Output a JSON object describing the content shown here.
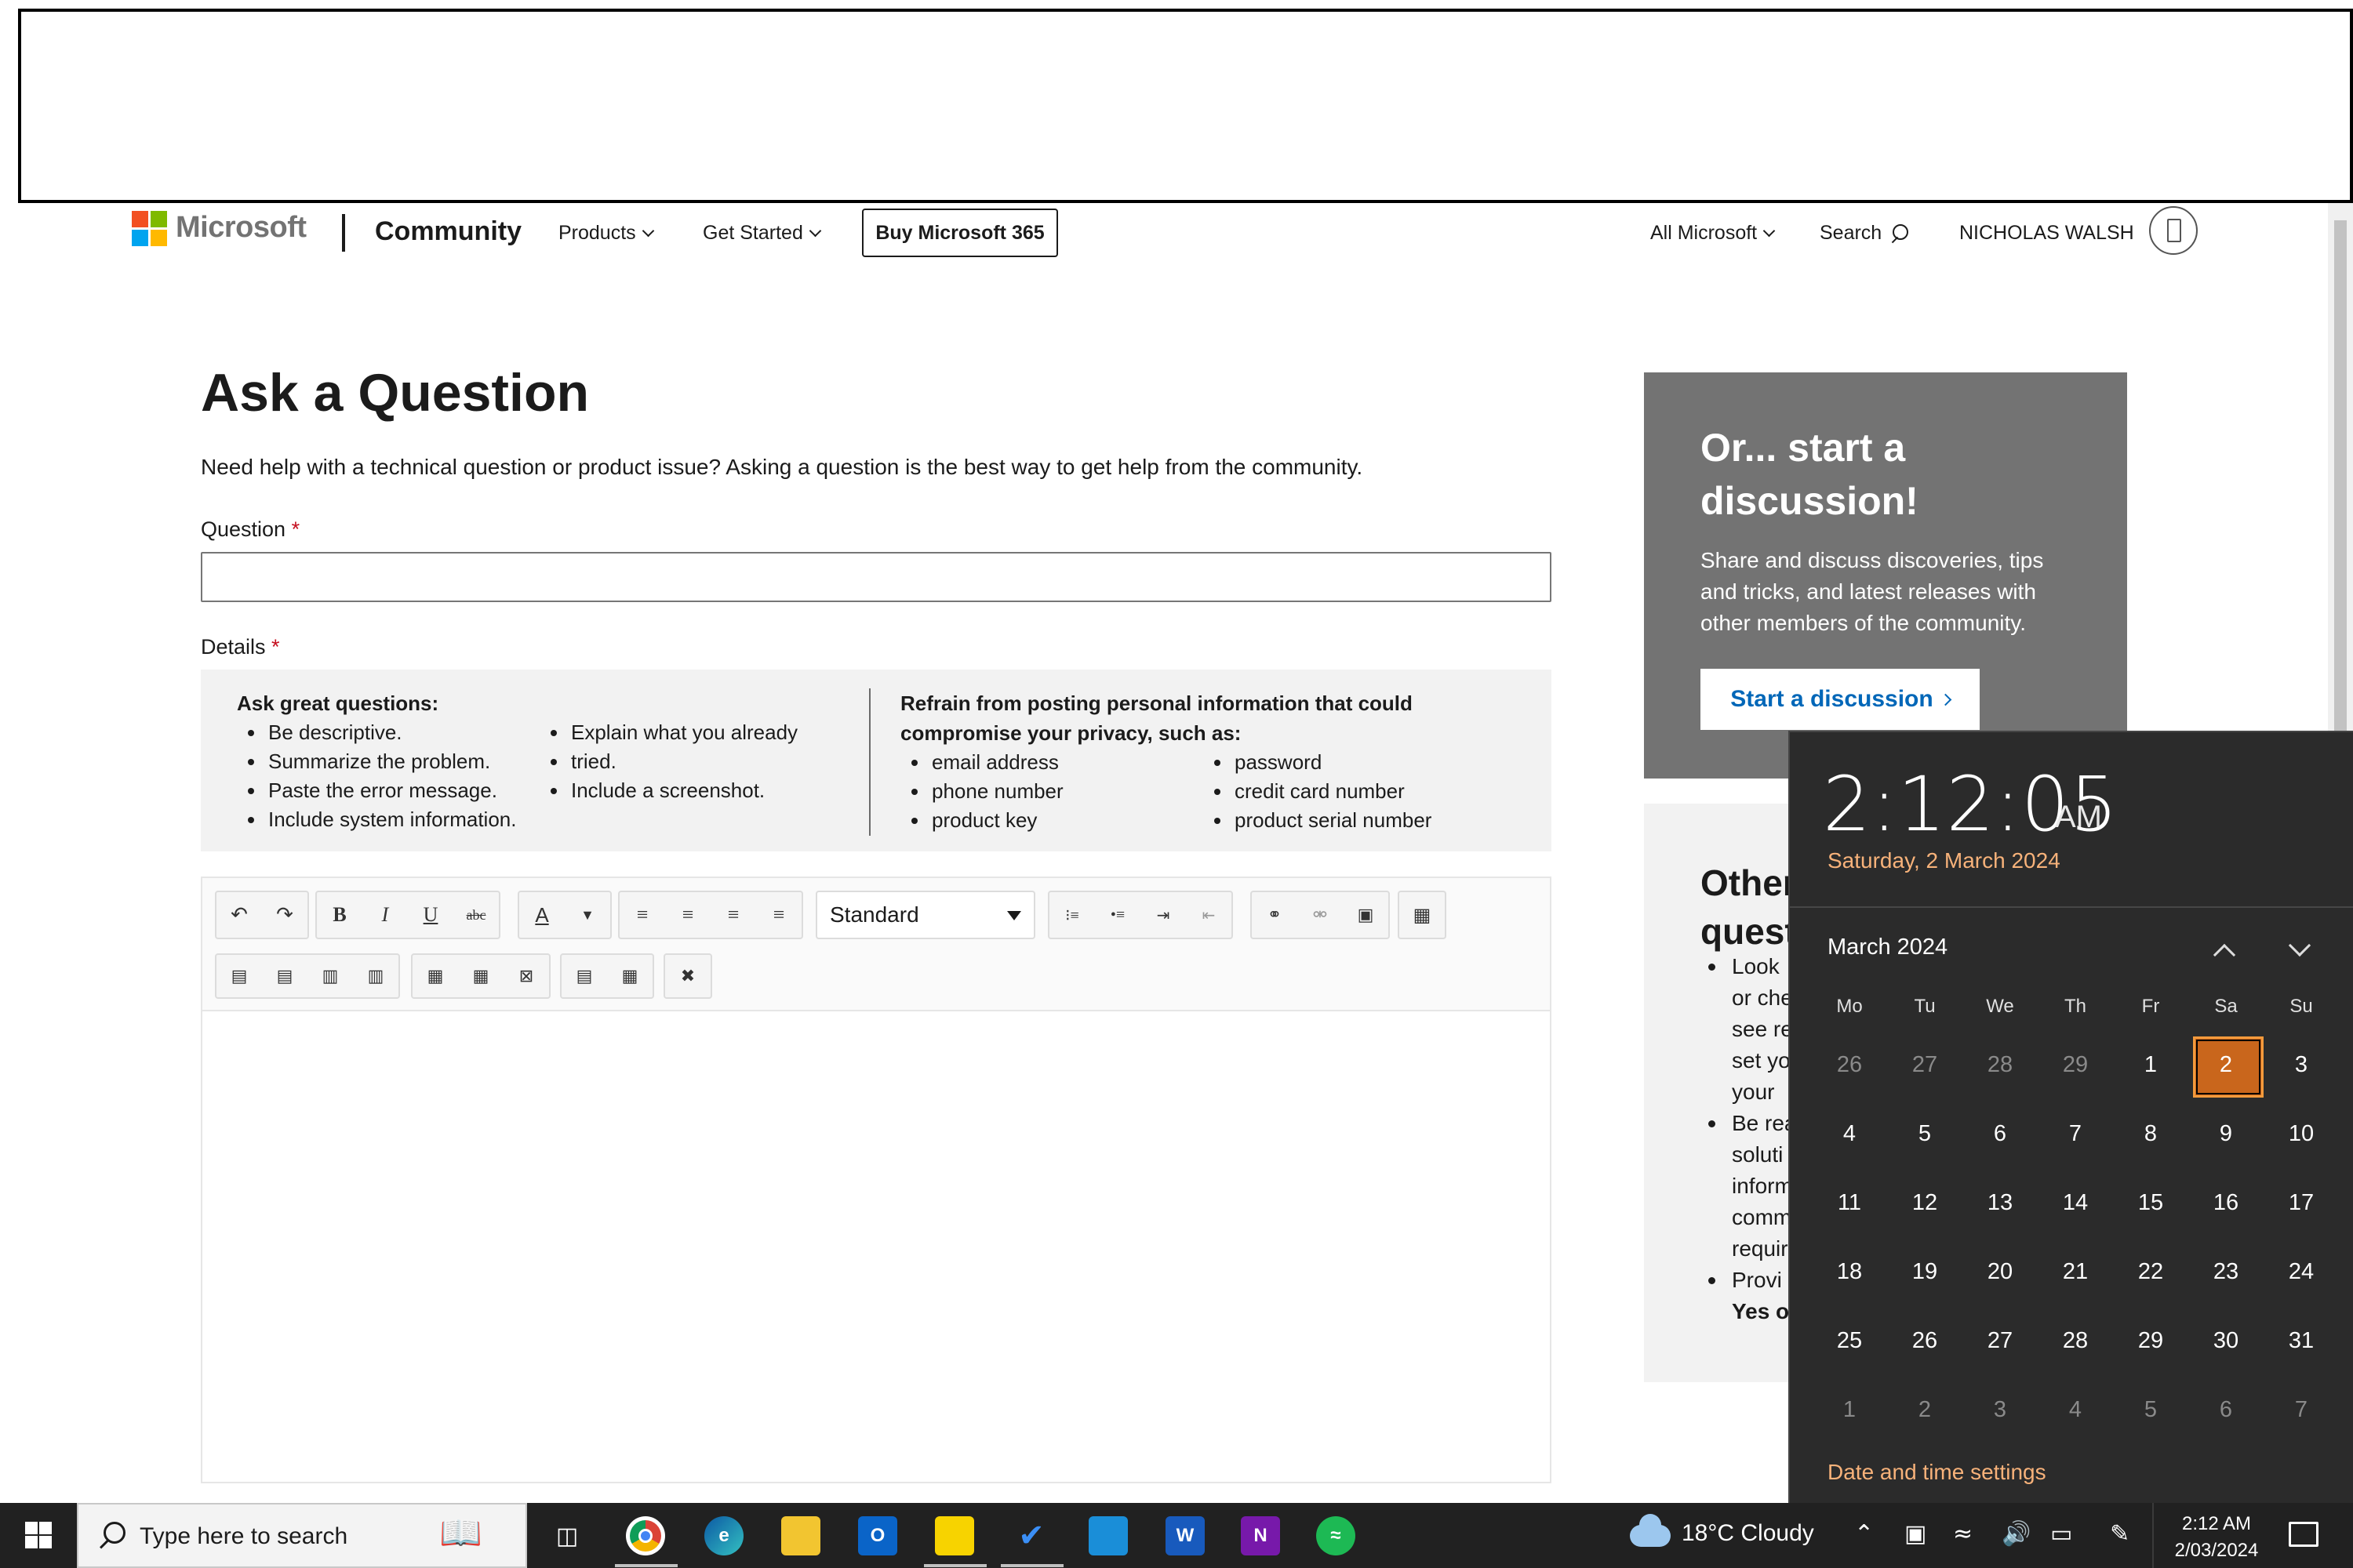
{
  "header": {
    "brand": "Microsoft",
    "site": "Community",
    "nav_products": "Products",
    "nav_get_started": "Get Started",
    "buy_button": "Buy Microsoft 365",
    "all_microsoft": "All Microsoft",
    "search": "Search",
    "user_name": "NICHOLAS WALSH"
  },
  "main": {
    "title": "Ask a Question",
    "intro": "Need help with a technical question or product issue? Asking a question is the best way to get help from the community.",
    "question_label": "Question",
    "details_label": "Details",
    "required_mark": "*",
    "tips": {
      "left_heading": "Ask great questions:",
      "left_col1": [
        "Be descriptive.",
        "Summarize the problem.",
        "Paste the error message.",
        "Include system information."
      ],
      "left_col2": [
        "Explain what you already",
        "tried.",
        "Include a screenshot."
      ],
      "right_heading_1": "Refrain from posting personal information that could",
      "right_heading_2": "compromise your privacy, such as:",
      "right_col1": [
        "email address",
        "phone number",
        "product key"
      ],
      "right_col2": [
        "password",
        "credit card number",
        "product serial number"
      ]
    },
    "editor": {
      "style_select": "Standard",
      "bold": "B",
      "italic": "I",
      "underline": "U",
      "strike": "abc",
      "font_color": "A"
    }
  },
  "sidebar": {
    "discussion_title": "Or... start a discussion!",
    "discussion_text": "Share and discuss discoveries, tips and tricks, and latest releases with other members of the community.",
    "discussion_button": "Start a discussion",
    "other_title_1": "Other",
    "other_title_2": "quest",
    "other_lines": [
      "Look",
      "or che",
      "see re",
      "set yo",
      "your",
      "Be rea",
      "soluti",
      "inform",
      "comm",
      "requir",
      "Provi",
      "Yes o"
    ]
  },
  "clock_flyout": {
    "time": "2:12:05",
    "ampm": "AM",
    "date": "Saturday, 2 March 2024",
    "month": "March 2024",
    "weekdays": [
      "Mo",
      "Tu",
      "We",
      "Th",
      "Fr",
      "Sa",
      "Su"
    ],
    "weeks": [
      [
        "26",
        "27",
        "28",
        "29",
        "1",
        "2",
        "3"
      ],
      [
        "4",
        "5",
        "6",
        "7",
        "8",
        "9",
        "10"
      ],
      [
        "11",
        "12",
        "13",
        "14",
        "15",
        "16",
        "17"
      ],
      [
        "18",
        "19",
        "20",
        "21",
        "22",
        "23",
        "24"
      ],
      [
        "25",
        "26",
        "27",
        "28",
        "29",
        "30",
        "31"
      ],
      [
        "1",
        "2",
        "3",
        "4",
        "5",
        "6",
        "7"
      ]
    ],
    "selected_day": "2",
    "settings_link": "Date and time settings"
  },
  "taskbar": {
    "search_placeholder": "Type here to search",
    "weather": "18°C  Cloudy",
    "clock_time": "2:12 AM",
    "clock_date": "2/03/2024",
    "apps": [
      "task-view-icon",
      "chrome-icon",
      "edge-icon",
      "file-explorer-icon",
      "outlook-new-icon",
      "sticky-notes-icon",
      "todo-icon",
      "store-icon",
      "word-icon",
      "onenote-icon",
      "spotify-icon"
    ]
  },
  "colors": {
    "accent_orange": "#c9661c",
    "link_blue": "#0067b8",
    "required_red": "#c50f1f",
    "flyout_bg": "#2b2b2b"
  }
}
